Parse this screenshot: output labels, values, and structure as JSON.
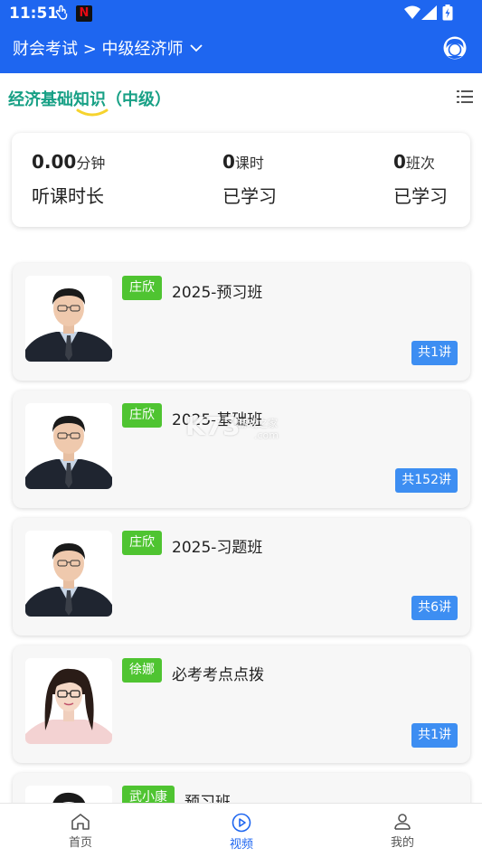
{
  "status_bar": {
    "time": "11:51",
    "netflix_glyph": "N"
  },
  "header": {
    "breadcrumb": "财会考试 > 中级经济师"
  },
  "subject": {
    "title": "经济基础知识（中级）"
  },
  "stats": [
    {
      "value": "0.00",
      "unit": "分钟",
      "label": "听课时长"
    },
    {
      "value": "0",
      "unit": "课时",
      "label": "已学习"
    },
    {
      "value": "0",
      "unit": "班次",
      "label": "已学习"
    }
  ],
  "courses": [
    {
      "teacher": "庄欣",
      "title": "2025-预习班",
      "count": "共1讲"
    },
    {
      "teacher": "庄欣",
      "title": "2025-基础班",
      "count": "共152讲"
    },
    {
      "teacher": "庄欣",
      "title": "2025-习题班",
      "count": "共6讲"
    },
    {
      "teacher": "徐娜",
      "title": "必考考点点拨",
      "count": "共1讲"
    },
    {
      "teacher": "武小康",
      "title": "预习班",
      "count": ""
    }
  ],
  "watermark": {
    "logo": "K73",
    "text": "游戏之家",
    "domain": ".com"
  },
  "nav": [
    {
      "label": "首页",
      "icon": "home-icon"
    },
    {
      "label": "视频",
      "icon": "play-icon"
    },
    {
      "label": "我的",
      "icon": "user-icon"
    }
  ],
  "colors": {
    "brand_blue": "#1e66f0",
    "subject_green": "#17a085",
    "teacher_badge": "#4fc431",
    "count_badge": "#3d8ef2"
  }
}
